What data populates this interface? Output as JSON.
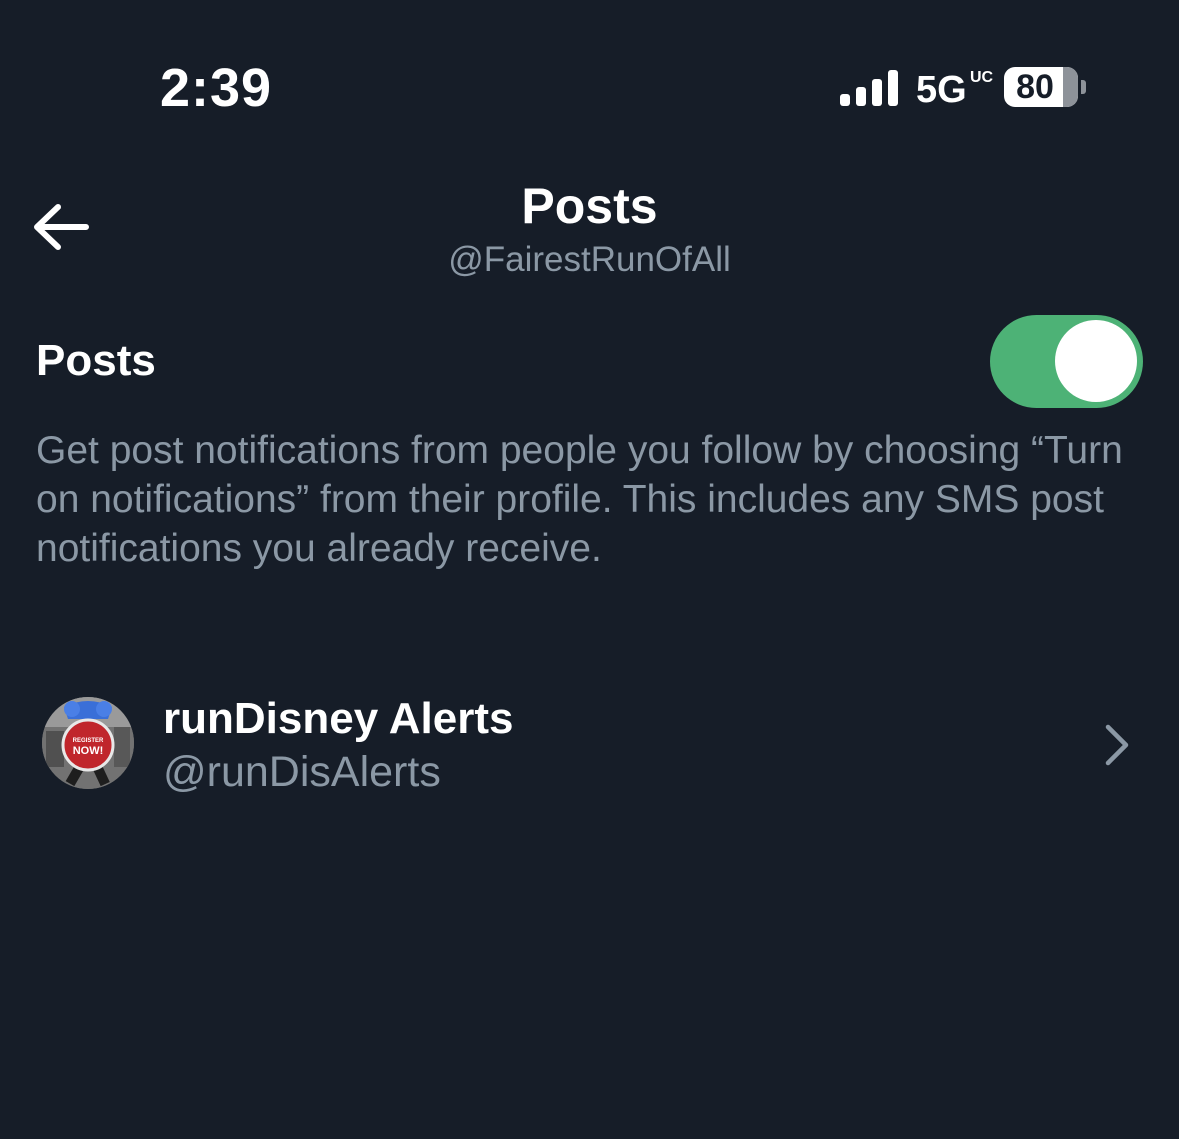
{
  "status_bar": {
    "time": "2:39",
    "network": "5G",
    "network_sup": "UC",
    "battery_level": 80
  },
  "header": {
    "title": "Posts",
    "subtitle": "@FairestRunOfAll",
    "back_icon": "arrow-left-icon"
  },
  "settings": {
    "section_label": "Posts",
    "toggle_on": true,
    "toggle_color": "#4db276",
    "description": "Get post notifications from people you follow by choosing “Turn on notifications” from their profile. This includes any SMS post notifications you already receive."
  },
  "accounts": [
    {
      "name": "runDisney Alerts",
      "handle": "@runDisAlerts",
      "avatar_badge_line1": "REGISTER",
      "avatar_badge_line2": "NOW!"
    }
  ]
}
